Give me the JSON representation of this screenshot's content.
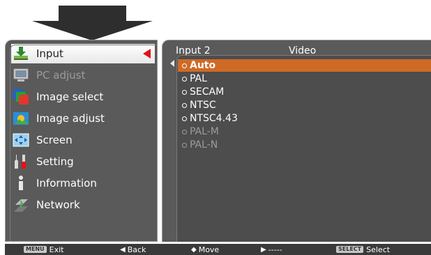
{
  "menu": {
    "items": [
      {
        "name": "input",
        "label": "Input",
        "icon": "input-icon",
        "selected": true
      },
      {
        "name": "pc-adjust",
        "label": "PC adjust",
        "icon": "pc-adjust-icon",
        "disabled": true
      },
      {
        "name": "image-select",
        "label": "Image select",
        "icon": "image-select-icon"
      },
      {
        "name": "image-adjust",
        "label": "Image adjust",
        "icon": "image-adjust-icon"
      },
      {
        "name": "screen",
        "label": "Screen",
        "icon": "screen-icon"
      },
      {
        "name": "setting",
        "label": "Setting",
        "icon": "setting-icon"
      },
      {
        "name": "information",
        "label": "Information",
        "icon": "information-icon"
      },
      {
        "name": "network",
        "label": "Network",
        "icon": "network-icon"
      }
    ]
  },
  "submenu": {
    "input_label": "Input 2",
    "mode_label": "Video",
    "options": [
      {
        "label": "Auto",
        "selected": true
      },
      {
        "label": "PAL"
      },
      {
        "label": "SECAM"
      },
      {
        "label": "NTSC"
      },
      {
        "label": "NTSC4.43"
      },
      {
        "label": "PAL-M",
        "disabled": true
      },
      {
        "label": "PAL-N",
        "disabled": true
      }
    ]
  },
  "bottom_bar": {
    "exit_key": "MENU",
    "exit_label": "Exit",
    "back_label": "Back",
    "move_label": "Move",
    "next_label": "-----",
    "select_key": "SELECT",
    "select_label": "Select"
  },
  "colors": {
    "highlight": "#cf6a26",
    "pointer": "#e0131a",
    "panel": "#5a5a5a"
  }
}
